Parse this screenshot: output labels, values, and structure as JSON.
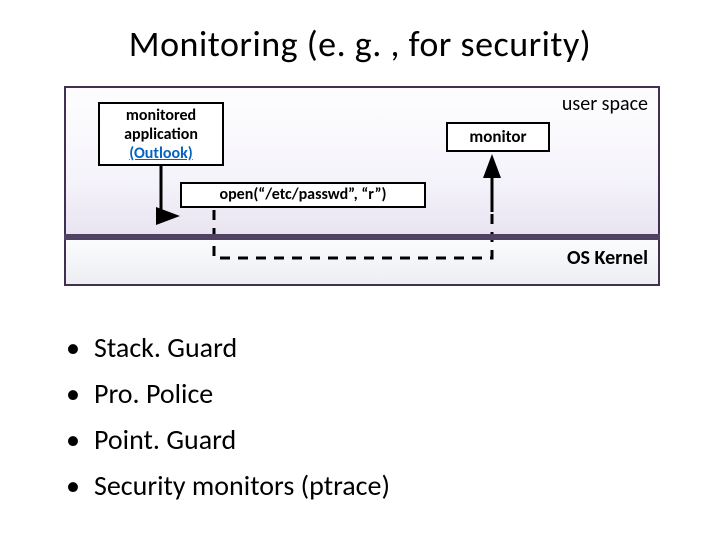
{
  "title": "Monitoring (e. g. , for security)",
  "diagram": {
    "userspace_label": "user space",
    "kernel_label": "OS Kernel",
    "app": {
      "line1": "monitored",
      "line2": "application",
      "outlook": "(Outlook)"
    },
    "call": "open(“/etc/passwd”, “r”)",
    "monitor": "monitor"
  },
  "bullets": [
    "Stack. Guard",
    "Pro. Police",
    "Point. Guard",
    "Security monitors (ptrace)"
  ]
}
